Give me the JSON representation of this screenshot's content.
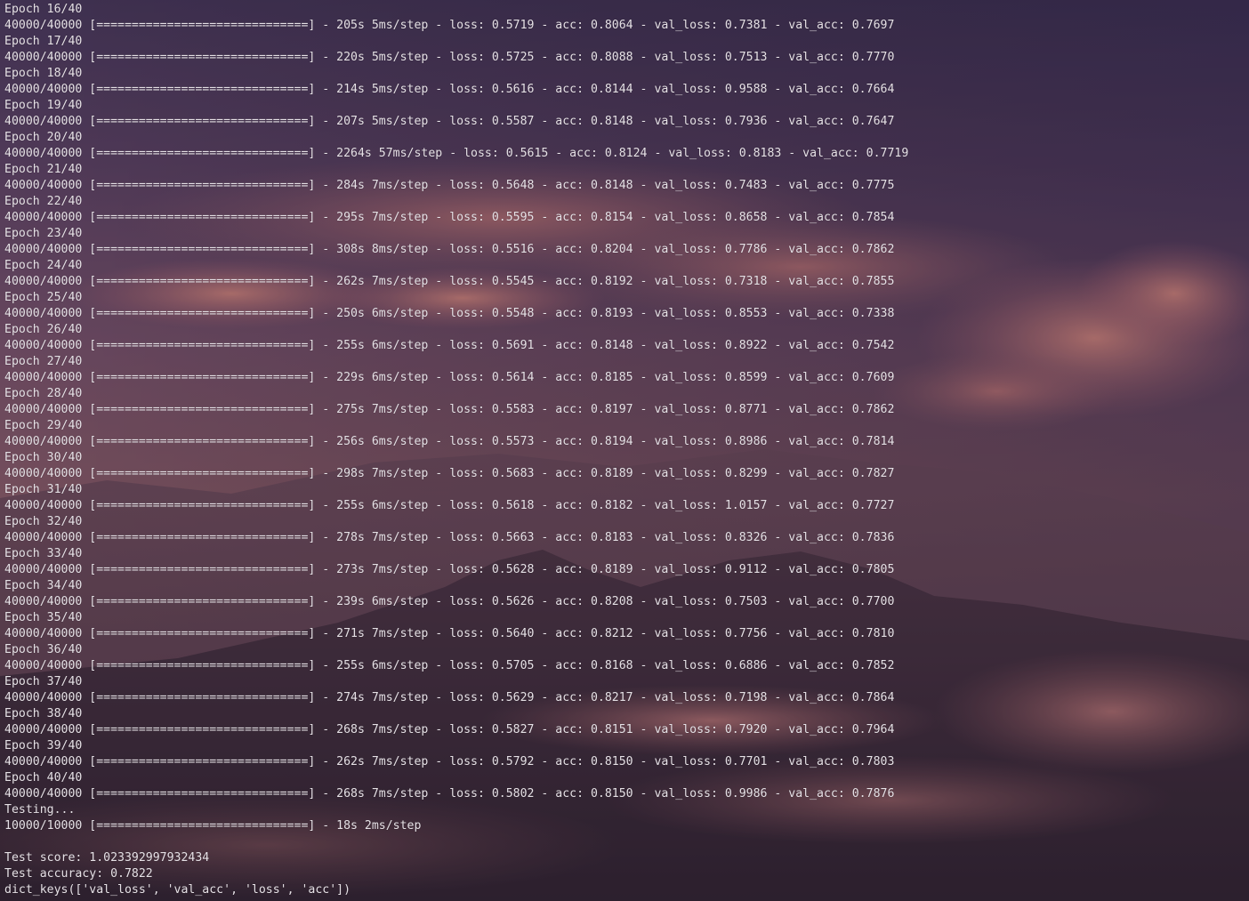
{
  "terminal": {
    "lines": [
      "Epoch 16/40",
      "40000/40000 [==============================] - 205s 5ms/step - loss: 0.5719 - acc: 0.8064 - val_loss: 0.7381 - val_acc: 0.7697",
      "Epoch 17/40",
      "40000/40000 [==============================] - 220s 5ms/step - loss: 0.5725 - acc: 0.8088 - val_loss: 0.7513 - val_acc: 0.7770",
      "Epoch 18/40",
      "40000/40000 [==============================] - 214s 5ms/step - loss: 0.5616 - acc: 0.8144 - val_loss: 0.9588 - val_acc: 0.7664",
      "Epoch 19/40",
      "40000/40000 [==============================] - 207s 5ms/step - loss: 0.5587 - acc: 0.8148 - val_loss: 0.7936 - val_acc: 0.7647",
      "Epoch 20/40",
      "40000/40000 [==============================] - 2264s 57ms/step - loss: 0.5615 - acc: 0.8124 - val_loss: 0.8183 - val_acc: 0.7719",
      "Epoch 21/40",
      "40000/40000 [==============================] - 284s 7ms/step - loss: 0.5648 - acc: 0.8148 - val_loss: 0.7483 - val_acc: 0.7775",
      "Epoch 22/40",
      "40000/40000 [==============================] - 295s 7ms/step - loss: 0.5595 - acc: 0.8154 - val_loss: 0.8658 - val_acc: 0.7854",
      "Epoch 23/40",
      "40000/40000 [==============================] - 308s 8ms/step - loss: 0.5516 - acc: 0.8204 - val_loss: 0.7786 - val_acc: 0.7862",
      "Epoch 24/40",
      "40000/40000 [==============================] - 262s 7ms/step - loss: 0.5545 - acc: 0.8192 - val_loss: 0.7318 - val_acc: 0.7855",
      "Epoch 25/40",
      "40000/40000 [==============================] - 250s 6ms/step - loss: 0.5548 - acc: 0.8193 - val_loss: 0.8553 - val_acc: 0.7338",
      "Epoch 26/40",
      "40000/40000 [==============================] - 255s 6ms/step - loss: 0.5691 - acc: 0.8148 - val_loss: 0.8922 - val_acc: 0.7542",
      "Epoch 27/40",
      "40000/40000 [==============================] - 229s 6ms/step - loss: 0.5614 - acc: 0.8185 - val_loss: 0.8599 - val_acc: 0.7609",
      "Epoch 28/40",
      "40000/40000 [==============================] - 275s 7ms/step - loss: 0.5583 - acc: 0.8197 - val_loss: 0.8771 - val_acc: 0.7862",
      "Epoch 29/40",
      "40000/40000 [==============================] - 256s 6ms/step - loss: 0.5573 - acc: 0.8194 - val_loss: 0.8986 - val_acc: 0.7814",
      "Epoch 30/40",
      "40000/40000 [==============================] - 298s 7ms/step - loss: 0.5683 - acc: 0.8189 - val_loss: 0.8299 - val_acc: 0.7827",
      "Epoch 31/40",
      "40000/40000 [==============================] - 255s 6ms/step - loss: 0.5618 - acc: 0.8182 - val_loss: 1.0157 - val_acc: 0.7727",
      "Epoch 32/40",
      "40000/40000 [==============================] - 278s 7ms/step - loss: 0.5663 - acc: 0.8183 - val_loss: 0.8326 - val_acc: 0.7836",
      "Epoch 33/40",
      "40000/40000 [==============================] - 273s 7ms/step - loss: 0.5628 - acc: 0.8189 - val_loss: 0.9112 - val_acc: 0.7805",
      "Epoch 34/40",
      "40000/40000 [==============================] - 239s 6ms/step - loss: 0.5626 - acc: 0.8208 - val_loss: 0.7503 - val_acc: 0.7700",
      "Epoch 35/40",
      "40000/40000 [==============================] - 271s 7ms/step - loss: 0.5640 - acc: 0.8212 - val_loss: 0.7756 - val_acc: 0.7810",
      "Epoch 36/40",
      "40000/40000 [==============================] - 255s 6ms/step - loss: 0.5705 - acc: 0.8168 - val_loss: 0.6886 - val_acc: 0.7852",
      "Epoch 37/40",
      "40000/40000 [==============================] - 274s 7ms/step - loss: 0.5629 - acc: 0.8217 - val_loss: 0.7198 - val_acc: 0.7864",
      "Epoch 38/40",
      "40000/40000 [==============================] - 268s 7ms/step - loss: 0.5827 - acc: 0.8151 - val_loss: 0.7920 - val_acc: 0.7964",
      "Epoch 39/40",
      "40000/40000 [==============================] - 262s 7ms/step - loss: 0.5792 - acc: 0.8150 - val_loss: 0.7701 - val_acc: 0.7803",
      "Epoch 40/40",
      "40000/40000 [==============================] - 268s 7ms/step - loss: 0.5802 - acc: 0.8150 - val_loss: 0.9986 - val_acc: 0.7876",
      "Testing...",
      "10000/10000 [==============================] - 18s 2ms/step",
      "",
      "Test score: 1.023392997932434",
      "Test accuracy: 0.7822",
      "dict_keys(['val_loss', 'val_acc', 'loss', 'acc'])"
    ]
  },
  "colors": {
    "text": "#e6e1e6",
    "sky_top": "#4b3a5e",
    "sky_mid": "#8a5a70",
    "sky_low": "#a86a6a",
    "mountain": "#3d2d3a"
  }
}
